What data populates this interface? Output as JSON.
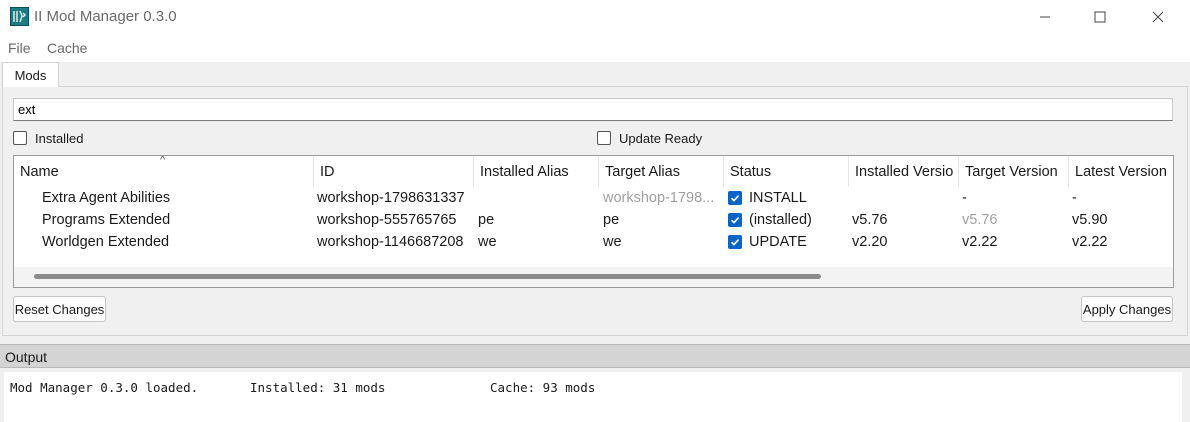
{
  "window": {
    "title": "II Mod Manager 0.3.0",
    "icons": {
      "app": "ii-app-icon",
      "minimize": "minimize-icon",
      "maximize": "maximize-icon",
      "close": "close-icon"
    }
  },
  "menu": [
    "File",
    "Cache"
  ],
  "tabs": [
    {
      "label": "Mods",
      "active": true
    }
  ],
  "search": {
    "value": "ext",
    "placeholder": ""
  },
  "filters": {
    "installed": {
      "label": "Installed",
      "checked": false
    },
    "update_ready": {
      "label": "Update Ready",
      "checked": false
    }
  },
  "table": {
    "sort_indicator": "^",
    "columns": [
      "Name",
      "ID",
      "Installed Alias",
      "Target Alias",
      "Status",
      "Installed Versio",
      "Target Version",
      "Latest Version"
    ],
    "rows": [
      {
        "name": "Extra Agent Abilities",
        "id": "workshop-1798631337",
        "installed_alias": "",
        "target_alias": "workshop-1798...",
        "status_checked": true,
        "status": "INSTALL",
        "installed_version": "",
        "target_version": "-",
        "latest_version": "-"
      },
      {
        "name": "Programs Extended",
        "id": "workshop-555765765",
        "installed_alias": "pe",
        "target_alias": "pe",
        "status_checked": true,
        "status": "(installed)",
        "installed_version": "v5.76",
        "target_version": "v5.76",
        "latest_version": "v5.90"
      },
      {
        "name": "Worldgen Extended",
        "id": "workshop-1146687208",
        "installed_alias": "we",
        "target_alias": "we",
        "status_checked": true,
        "status": "UPDATE",
        "installed_version": "v2.20",
        "target_version": "v2.22",
        "latest_version": "v2.22"
      }
    ]
  },
  "buttons": {
    "reset": "Reset Changes",
    "apply": "Apply Changes"
  },
  "output": {
    "header": "Output",
    "loaded": "Mod Manager 0.3.0 loaded.",
    "installed": "Installed: 31 mods",
    "cache": "Cache: 93 mods"
  },
  "colors": {
    "accent": "#0a63c9",
    "muted_text": "#a0a0a0",
    "app_icon": "#1d7b86"
  }
}
